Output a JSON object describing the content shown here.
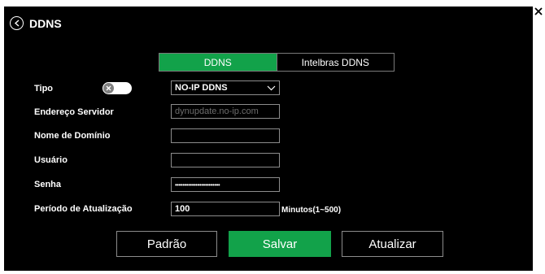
{
  "window": {
    "title": "DDNS"
  },
  "tabs": [
    {
      "label": "DDNS",
      "active": true
    },
    {
      "label": "Intelbras DDNS",
      "active": false
    }
  ],
  "form": {
    "tipo": {
      "label": "Tipo",
      "toggle_on": false,
      "value": "NO-IP DDNS"
    },
    "servidor": {
      "label": "Endereço Servidor",
      "placeholder": "dynupdate.no-ip.com",
      "value": ""
    },
    "dominio": {
      "label": "Nome de Domínio",
      "value": ""
    },
    "usuario": {
      "label": "Usuário",
      "value": ""
    },
    "senha": {
      "label": "Senha",
      "value": "••••••••••••••••••••••••"
    },
    "periodo": {
      "label": "Período de Atualização",
      "value": "100",
      "units": "Minutos(1~500)"
    }
  },
  "buttons": {
    "padrao": "Padrão",
    "salvar": "Salvar",
    "atualizar": "Atualizar"
  },
  "colors": {
    "accent": "#12a24a",
    "background": "#000000",
    "border": "#8c8c8c"
  }
}
